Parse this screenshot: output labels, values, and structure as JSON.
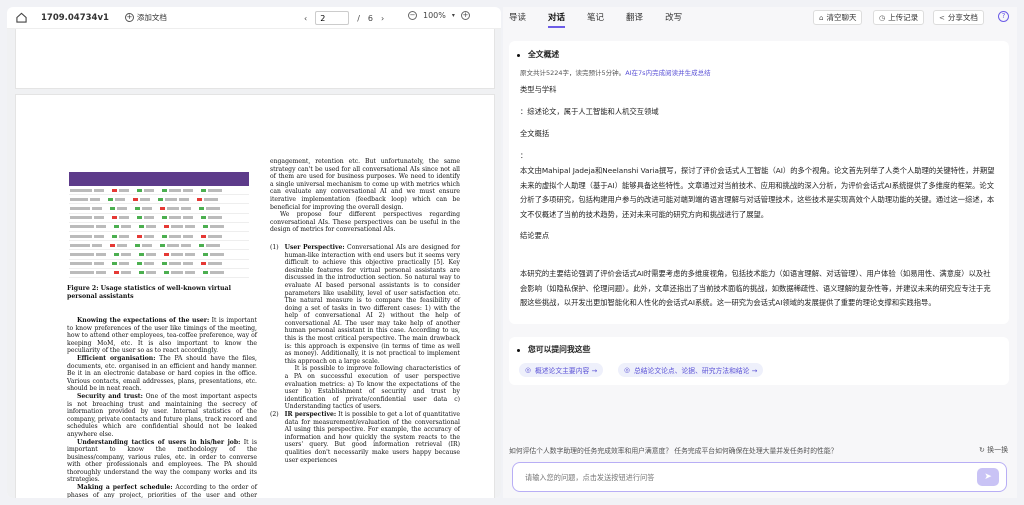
{
  "toolbar": {
    "file_title": "1709.04734v1",
    "add_doc": "添加文档",
    "page_current": "2",
    "page_sep": "/",
    "page_total": "6",
    "zoom": "100%"
  },
  "paper": {
    "figure_caption": "Figure 2: Usage statistics of well-known virtual personal assistants",
    "left_col": [
      {
        "lead": "Knowing the expectations of the user:",
        "text": " It is important to know preferences of the user like timings of the meeting, how to attend other employees, tea-coffee preference, way of keeping MoM, etc. It is also important to know the peculiarity of the user so as to react accordingly."
      },
      {
        "lead": "Efficient organisation:",
        "text": " The PA should have the files, documents, etc. organised in an efficient and handy manner. Be it in an electronic database or hard copies in the office. Various contacts, email addresses, plans, presentations, etc. should be in neat reach."
      },
      {
        "lead": "Security and trust:",
        "text": " One of the most important aspects is not breaching trust and maintaining the secrecy of information provided by user. Internal statistics of the company, private contacts and future plans, track record and schedules which are confidential should not be leaked anywhere else."
      },
      {
        "lead": "Understanding tactics of users in his/her job:",
        "text": " It is important to know the methodology of the business/company, various rules, etc. in order to converse with other professionals and employees. The PA should thoroughly understand the way the company works and its strategies."
      },
      {
        "lead": "Making a perfect schedule:",
        "text": " According to the order of phases of any project, priorities of the user and other employees, temporal"
      }
    ],
    "right_intro": "engagement, retention etc. But unfortunately, the same strategy can't be used for all conversational AIs since not all of them are used for business purposes. We need to identify a single universal mechanism to come up with metrics which can evaluate any conversational AI and we must ensure iterative implementation (feedback loop) which can be beneficial for improving the overall design.",
    "right_intro2": "We propose four different perspectives regarding conversational AIs. These perspectives can be useful in the design of metrics for conversational AIs.",
    "item1_num": "(1)",
    "item1_lead": "User Perspective:",
    "item1_text": " Conversational AIs are designed for human-like interaction with end users but it seems very difficult to achieve this objective practically [5]. Key desirable features for virtual personal assistants are discussed in the introduction section. So natural way to evaluate AI based personal assistants is to consider parameters like usability, level of user satisfaction etc. The natural measure is to compare the feasibility of doing a set of tasks in two different cases: 1) with the help of conversational AI 2) without the help of conversational AI. The user may take help of another human personal assistant in this case. According to us, this is the most critical perspective. The main drawback is: this approach is expensive (in terms of time as well as money). Additionally, it is not practical to implement this approach on a large scale.",
    "item1_text2": "It is possible to improve following characteristics of a PA on successful execution of user perspective evaluation metrics: a) To know the expectations of the user b) Establishment of security and trust by identification of private/confidential user data c) Understanding tactics of users.",
    "item2_num": "(2)",
    "item2_lead": "IR perspective:",
    "item2_text": " It is possible to get a lot of quantitative data for measurement/evaluation of the conversational AI using this perspective. For example, the accuracy of information and how quickly the system reacts to the users' query. But good information retrieval (IR) qualities don't necessarily make users happy because user experiences"
  },
  "tabs": [
    "导读",
    "对话",
    "笔记",
    "翻译",
    "改写"
  ],
  "active_tab": "对话",
  "actions": {
    "clear": "清空聊天",
    "upload": "上传记录",
    "share": "分享文档",
    "help": "?"
  },
  "summary": {
    "title": "全文概述",
    "meta_plain": "原文共计5224字，读完预计5分钟。",
    "meta_link": "AI在7s内完成阅读并生成总结",
    "type_heading": "类型与学科",
    "type_value": "：综述论文，属于人工智能和人机交互领域",
    "overview_heading": "全文概括",
    "colon": "：",
    "overview_text": "本文由Mahipal Jadeja和Neelanshi Varia撰写，探讨了评价会话式人工智能（AI）的多个视角。论文首先列举了人类个人助理的关键特性，并期望未来的虚拟个人助理（基于AI）能够具备这些特性。文章通过对当前技术、应用和挑战的深入分析，为评价会话式AI系统提供了多维度的框架。论文分析了多项研究，包括构建用户参与的改进可能对端到端的语言理解与对话管理技术，这些技术是实现高效个人助理功能的关键。通过这一综述，本文不仅概述了当前的技术趋势，还对未来可能的研究方向和挑战进行了展望。",
    "conclusion_heading": "结论要点",
    "conclusion_text": "本研究的主要结论强调了评价会话式AI时需要考虑的多维度视角，包括技术能力（如语言理解、对话管理）、用户体验（如易用性、满意度）以及社会影响（如隐私保护、伦理问题）。此外，文章还指出了当前技术面临的挑战，如数据稀疏性、语义理解的复杂性等，并建议未来的研究应专注于克服这些挑战，以开发出更加智能化和人性化的会话式AI系统。这一研究为会话式AI领域的发展提供了重要的理论支撑和实践指导。"
  },
  "suggest": {
    "title": "您可以提问我这些",
    "q1": "概述论文主要内容 →",
    "q2": "总结论文论点、论据、研究方法和结论 →"
  },
  "questions_line": "如何评估个人数字助理的任务完成效率和用户满意度？  任务完成平台如何确保在处理大量并发任务时的性能？",
  "swap_label": "换一换",
  "input_placeholder": "请输入您的问题，点击发送按钮进行问答",
  "colors": {
    "accent": "#6c5ce7",
    "table_header": "#5d3b8a"
  },
  "icons": [
    "home-icon",
    "plus-icon",
    "chevron-left-icon",
    "chevron-right-icon",
    "zoom-out-icon",
    "zoom-in-icon",
    "broom-icon",
    "clock-icon",
    "share-icon",
    "help-icon",
    "refresh-icon",
    "send-icon"
  ]
}
